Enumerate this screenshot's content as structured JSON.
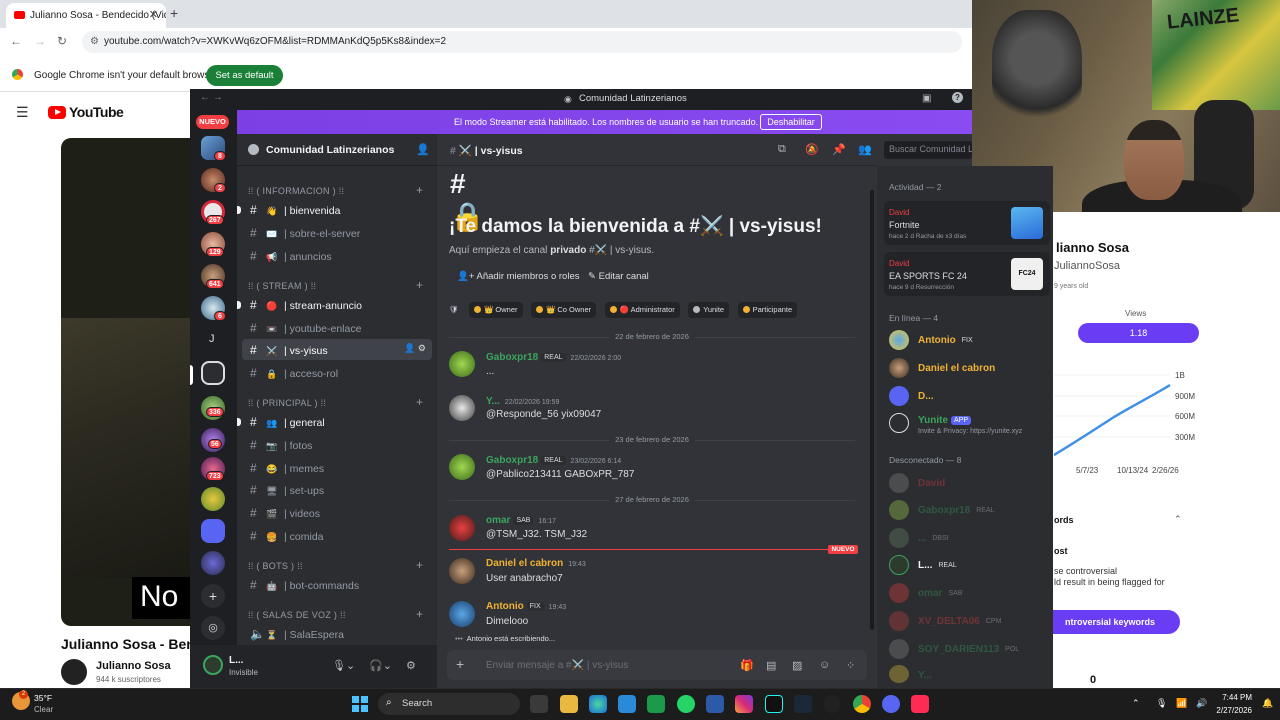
{
  "browser": {
    "tab_title": "Julianno Sosa - Bendecido (Vide",
    "tab_close": "✕",
    "new_tab": "+",
    "url": "youtube.com/watch?v=XWKvWq6zOFM&list=RDMMAnKdQ5p5Ks8&index=2",
    "infobar_text": "Google Chrome isn't your default browser",
    "infobar_button": "Set as default",
    "nav_back": "←",
    "nav_forward": "→",
    "nav_reload": "↻"
  },
  "youtube": {
    "wordmark": "YouTube",
    "menu_icon": "☰",
    "video_subtitle": "No",
    "video_title": "Julianno Sosa - Bendecido",
    "channel_name": "Julianno Sosa",
    "channel_subs": "944 k suscriptores",
    "right_panel": {
      "name": "lianno Sosa",
      "handle": "JuliannoSosa",
      "joined": "9 years old",
      "views_label": "Views",
      "views_value": "1.18",
      "chart_ticks": [
        "1B",
        "900M",
        "600M",
        "300M"
      ],
      "chart_dates": [
        "5/7/23",
        "10/13/24",
        "2/26/26"
      ],
      "words_title": "ords",
      "words_post": "ost",
      "words_desc": "se controversial\nld result in being flagged for",
      "words_button": "ntroversial keywords",
      "bottom_count": "0"
    }
  },
  "discord": {
    "window_title": "Comunidad Latinzerianos",
    "nav_back": "←",
    "nav_forward": "→",
    "banner_text": "El modo Streamer está habilitado. Los nombres de usuario se han truncado.",
    "banner_button": "Deshabilitar",
    "new_pill": "NUEVO",
    "server_name": "Comunidad Latinzerianos",
    "server_badges": [
      "8",
      "2",
      "267",
      "129",
      "641",
      "6",
      "336",
      "56",
      "723"
    ],
    "server_letter": "J",
    "categories": {
      "info": "⁞⁞ ( INFORMACION ) ⁞⁞",
      "stream": "⁞⁞ ( STREAM ) ⁞⁞",
      "principal": "⁞⁞ ( PRINCIPAL ) ⁞⁞",
      "bots": "⁞⁞ ( BOTS ) ⁞⁞",
      "voz": "⁞⁞ ( SALAS DE VOZ ) ⁞⁞"
    },
    "channels": {
      "bienvenida": "| bienvenida",
      "sobre": "| sobre-el-server",
      "anuncios": "| anuncios",
      "stream_anuncio": "| stream-anuncio",
      "youtube_enlace": "| youtube-enlace",
      "vs_yisus": "| vs-yisus",
      "acceso_rol": "| acceso-rol",
      "general": "| general",
      "fotos": "| fotos",
      "memes": "| memes",
      "setups": "| set-ups",
      "videos": "| videos",
      "comida": "| comida",
      "bot_commands": "| bot-commands",
      "sala_espera": "| SalaEspera"
    },
    "user": {
      "name": "L...",
      "status": "Invisible"
    },
    "chat": {
      "channel": "| vs-yisus",
      "search_placeholder": "Buscar Comunidad L",
      "welcome_title": "¡Te damos la bienvenida a #⚔️ | vs-yisus!",
      "welcome_desc_prefix": "Aquí empieza el canal",
      "welcome_desc_bold": "privado",
      "welcome_desc_suffix": "#⚔️ | vs-yisus.",
      "add_members": "Añadir miembros o roles",
      "edit_channel": "Editar canal",
      "roles": [
        "👑 Owner",
        "👑 Co Owner",
        "🔴 Administrator",
        "Yunite",
        "Participante"
      ],
      "date1": "22 de febrero de 2026",
      "date2": "23 de febrero de 2026",
      "date3": "27 de febrero de 2026",
      "messages": [
        {
          "author": "Gaboxpr18",
          "tag": "REAL",
          "time": "22/02/2026 2:00",
          "text": "..."
        },
        {
          "author": "Y...",
          "tag": "",
          "time": "22/02/2026 19:59",
          "text": "@Responde_56  yix09047"
        },
        {
          "author": "Gaboxpr18",
          "tag": "REAL",
          "time": "23/02/2026 6:14",
          "text": "@Pablico213411 GABOxPR_787"
        },
        {
          "author": "omar",
          "tag": "SAB",
          "time": "16:17",
          "text": "@TSM_J32. TSM_J32"
        },
        {
          "author": "Daniel el cabron",
          "tag": "",
          "time": "19:43",
          "text": "User anabracho7"
        },
        {
          "author": "Antonio",
          "tag": "FIX",
          "time": "19:43",
          "text": "Dimelooo"
        }
      ],
      "new_label": "NUEVO",
      "typing": "Antonio está escribiendo...",
      "input_placeholder": "Enviar mensaje a #⚔️ | vs-yisus"
    },
    "members": {
      "activity_header": "Actividad — 2",
      "activities": [
        {
          "name": "David",
          "game": "Fortnite",
          "sub": "hace 2 d   Racha de x3 días"
        },
        {
          "name": "David",
          "game": "EA SPORTS FC 24",
          "sub": "hace 9 d   Resurrección"
        }
      ],
      "online_header": "En línea — 4",
      "online": [
        {
          "name": "Antonio",
          "tag": "FIX",
          "sub": ""
        },
        {
          "name": "Daniel el cabron",
          "tag": "",
          "sub": ""
        },
        {
          "name": "D...",
          "tag": "",
          "sub": ""
        },
        {
          "name": "Yunite",
          "tag": "APP",
          "sub": "Invite & Privacy: https://yunite.xyz"
        }
      ],
      "offline_header": "Desconectado — 8",
      "offline": [
        {
          "name": "David",
          "tag": ""
        },
        {
          "name": "Gaboxpr18",
          "tag": "REAL"
        },
        {
          "name": "...",
          "tag": "DBSI"
        },
        {
          "name": "L...",
          "tag": "REAL"
        },
        {
          "name": "omar",
          "tag": "SAB"
        },
        {
          "name": "XV_DELTA06",
          "tag": "CPM"
        },
        {
          "name": "SOY_DARIEN113",
          "tag": "POL"
        },
        {
          "name": "Y...",
          "tag": ""
        }
      ]
    }
  },
  "taskbar": {
    "temp": "35°F",
    "weather": "Clear",
    "weather_badge": "2",
    "search": "Search",
    "time": "7:44 PM",
    "date": "2/27/2026"
  },
  "colors": {
    "discord_bg": "#313338",
    "sidebar_bg": "#2b2d31",
    "rail_bg": "#1e1f22",
    "streamer_banner": "#8a4cf0",
    "new_red": "#f23f43",
    "youtube_red": "#ff0000",
    "yt_purple": "#6a3df5"
  }
}
